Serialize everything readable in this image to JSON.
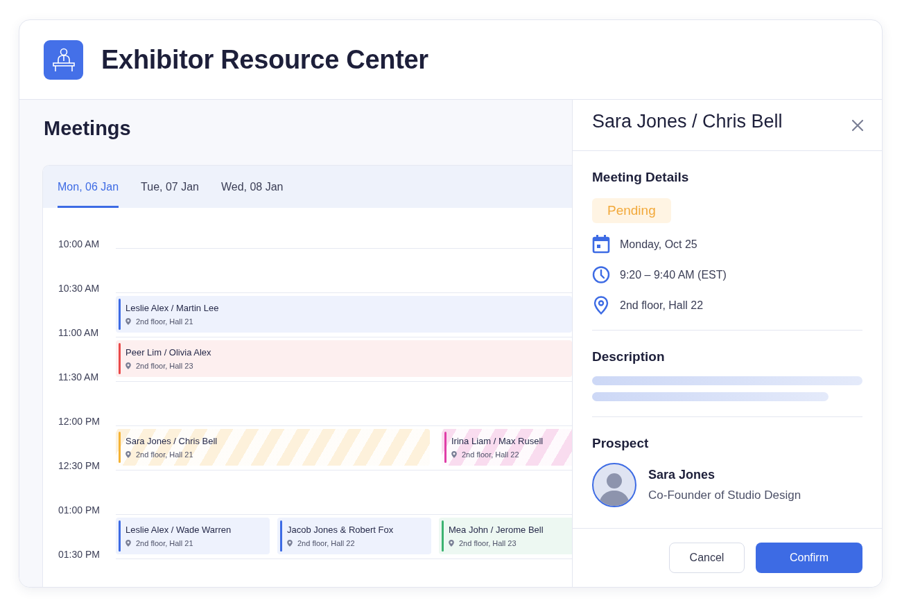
{
  "header": {
    "title": "Exhibitor Resource Center"
  },
  "page_title": "Meetings",
  "day_tabs": [
    {
      "label": "Mon, 06 Jan",
      "selected": true
    },
    {
      "label": "Tue, 07 Jan",
      "selected": false
    },
    {
      "label": "Wed, 08 Jan",
      "selected": false
    }
  ],
  "time_slots": [
    {
      "time": "10:00 AM"
    },
    {
      "time": "10:30 AM",
      "meetings": [
        {
          "title": "Leslie Alex / Martin Lee",
          "location": "2nd floor, Hall 21",
          "color": "#3d6be4",
          "pending": false
        }
      ]
    },
    {
      "time": "11:00 AM",
      "meetings": [
        {
          "title": "Peer Lim / Olivia Alex",
          "location": "2nd floor, Hall 23",
          "color": "#ea4a4a",
          "pending": false
        }
      ]
    },
    {
      "time": "11:30 AM"
    },
    {
      "time": "12:00 PM",
      "meetings": [
        {
          "title": "Sara Jones / Chris Bell",
          "location": "2nd floor, Hall 21",
          "color": "#f5b335",
          "pending": true
        },
        {
          "title": "Irina Liam / Max Rusell",
          "location": "2nd floor, Hall 22",
          "color": "#e03fa8",
          "pending": true
        }
      ]
    },
    {
      "time": "12:30 PM"
    },
    {
      "time": "01:00 PM",
      "meetings": [
        {
          "title": "Leslie Alex / Wade Warren",
          "location": "2nd floor, Hall 21",
          "color": "#3d6be4",
          "pending": false
        },
        {
          "title": "Jacob Jones & Robert Fox",
          "location": "2nd floor, Hall 22",
          "color": "#3d6be4",
          "pending": false
        },
        {
          "title": "Mea John / Jerome Bell",
          "location": "2nd floor, Hall 23",
          "color": "#3cb371",
          "pending": false
        }
      ]
    },
    {
      "time": "01:30 PM"
    }
  ],
  "detail": {
    "title": "Sara Jones / Chris Bell",
    "meeting_details": {
      "heading": "Meeting Details",
      "status": "Pending",
      "items": [
        {
          "kind": "date",
          "text": "Monday, Oct 25"
        },
        {
          "kind": "time",
          "text": "9:20 – 9:40 AM (EST)"
        },
        {
          "kind": "location",
          "text": "2nd floor, Hall 22"
        }
      ]
    },
    "description": {
      "heading": "Description"
    },
    "prospect": {
      "heading": "Prospect",
      "name": "Sara Jones",
      "role": "Co-Founder of Studio Design"
    },
    "buttons": [
      {
        "label": "Cancel",
        "kind": "secondary"
      },
      {
        "label": "Confirm",
        "kind": "primary"
      }
    ]
  }
}
